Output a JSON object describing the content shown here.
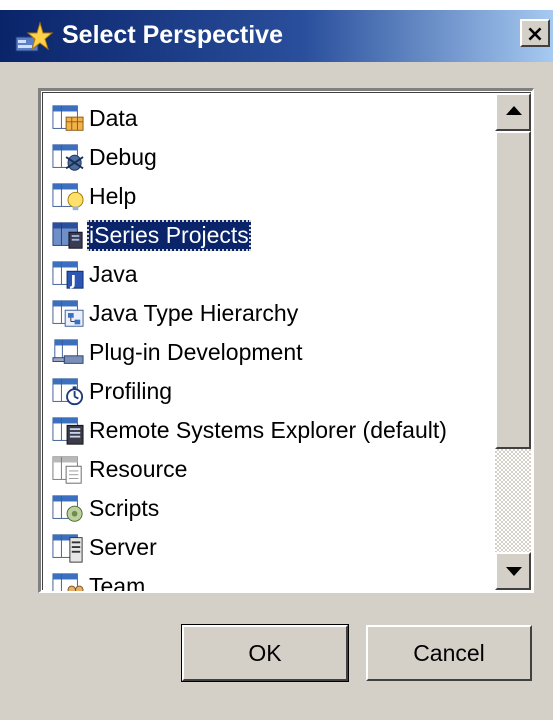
{
  "dialog": {
    "title": "Select Perspective",
    "close_label": "×"
  },
  "perspectives": [
    {
      "label": "Data",
      "icon": "data-perspective-icon",
      "selected": false
    },
    {
      "label": "Debug",
      "icon": "debug-perspective-icon",
      "selected": false
    },
    {
      "label": "Help",
      "icon": "help-perspective-icon",
      "selected": false
    },
    {
      "label": "iSeries Projects",
      "icon": "iseries-projects-perspective-icon",
      "selected": true
    },
    {
      "label": "Java",
      "icon": "java-perspective-icon",
      "selected": false
    },
    {
      "label": "Java Type Hierarchy",
      "icon": "java-type-hierarchy-perspective-icon",
      "selected": false
    },
    {
      "label": "Plug-in Development",
      "icon": "plugin-development-perspective-icon",
      "selected": false
    },
    {
      "label": "Profiling",
      "icon": "profiling-perspective-icon",
      "selected": false
    },
    {
      "label": "Remote Systems Explorer (default)",
      "icon": "remote-systems-perspective-icon",
      "selected": false
    },
    {
      "label": "Resource",
      "icon": "resource-perspective-icon",
      "selected": false
    },
    {
      "label": "Scripts",
      "icon": "scripts-perspective-icon",
      "selected": false
    },
    {
      "label": "Server",
      "icon": "server-perspective-icon",
      "selected": false
    },
    {
      "label": "Team",
      "icon": "team-perspective-icon",
      "selected": false
    }
  ],
  "buttons": {
    "ok_label": "OK",
    "cancel_label": "Cancel"
  },
  "colors": {
    "titlebar_start": "#0a246a",
    "titlebar_end": "#a6caf0",
    "selection": "#0a246a",
    "face": "#d4d0c8"
  }
}
